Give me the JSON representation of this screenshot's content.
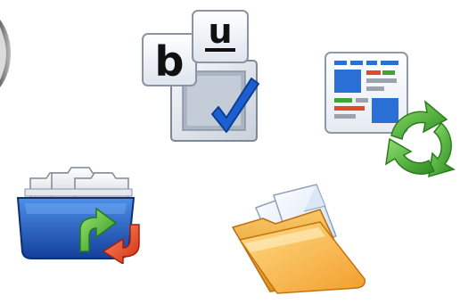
{
  "icons": [
    {
      "name": "partial-edge-icon"
    },
    {
      "name": "text-formatting-checkbox-icon",
      "glyphs": {
        "bold": "b",
        "underline": "u"
      }
    },
    {
      "name": "page-refresh-icon"
    },
    {
      "name": "archive-restore-icon"
    },
    {
      "name": "open-folder-icon"
    }
  ],
  "colors": {
    "check_blue": "#1c5fd0",
    "recycle_green": "#3ea632",
    "folder_orange": "#f0a236",
    "archive_blue": "#1e62c8"
  }
}
